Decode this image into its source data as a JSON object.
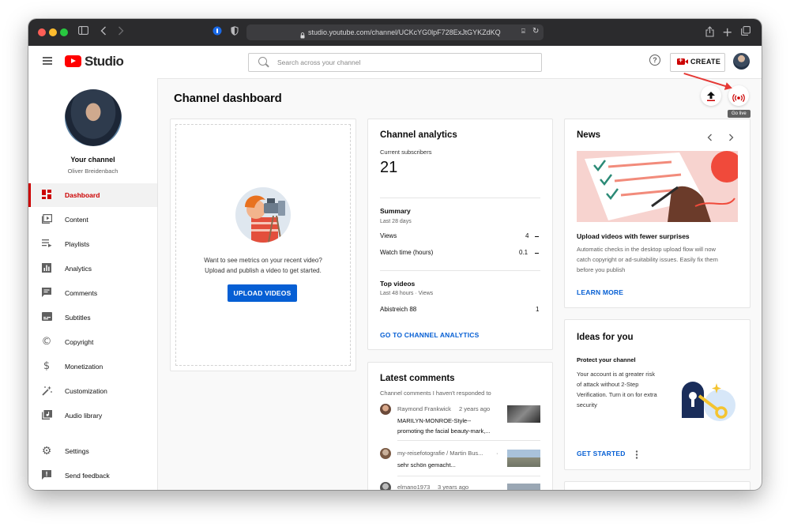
{
  "browser": {
    "url": "studio.youtube.com/channel/UCKcYG0lpF728ExJtGYKZdKQ",
    "icons": [
      "sidebar-icon",
      "back-icon",
      "forward-icon",
      "password-icon",
      "shield-icon",
      "lock-icon",
      "translate-icon",
      "reload-icon",
      "share-icon",
      "new-tab-icon",
      "tabs-icon"
    ]
  },
  "header": {
    "logo_text": "Studio",
    "search_placeholder": "Search across your channel",
    "create_label": "CREATE"
  },
  "sidebar": {
    "channel_label": "Your channel",
    "owner_name": "Oliver Breidenbach",
    "items": [
      {
        "label": "Dashboard",
        "icon": "dashboard-icon",
        "active": true
      },
      {
        "label": "Content",
        "icon": "content-icon"
      },
      {
        "label": "Playlists",
        "icon": "playlists-icon"
      },
      {
        "label": "Analytics",
        "icon": "analytics-icon"
      },
      {
        "label": "Comments",
        "icon": "comments-icon"
      },
      {
        "label": "Subtitles",
        "icon": "subtitles-icon"
      },
      {
        "label": "Copyright",
        "icon": "copyright-icon"
      },
      {
        "label": "Monetization",
        "icon": "monetization-icon"
      },
      {
        "label": "Customization",
        "icon": "customization-icon"
      },
      {
        "label": "Audio library",
        "icon": "audio-library-icon"
      },
      {
        "label": "Settings",
        "icon": "settings-icon"
      },
      {
        "label": "Send feedback",
        "icon": "feedback-icon"
      }
    ]
  },
  "main": {
    "title": "Channel dashboard",
    "go_live_tooltip": "Go live",
    "upload_card": {
      "hint_line1": "Want to see metrics on your recent video?",
      "hint_line2": "Upload and publish a video to get started.",
      "button": "UPLOAD VIDEOS"
    },
    "analytics": {
      "title": "Channel analytics",
      "subs_label": "Current subscribers",
      "subs_value": "21",
      "summary_title": "Summary",
      "summary_period": "Last 28 days",
      "rows": [
        {
          "label": "Views",
          "value": "4"
        },
        {
          "label": "Watch time (hours)",
          "value": "0.1"
        }
      ],
      "top_title": "Top videos",
      "top_period": "Last 48 hours · Views",
      "top_videos": [
        {
          "title": "Abistreich 88",
          "views": "1"
        }
      ],
      "link": "GO TO CHANNEL ANALYTICS"
    },
    "comments": {
      "title": "Latest comments",
      "subtitle": "Channel comments I haven't responded to",
      "items": [
        {
          "author": "Raymond Frankwick",
          "time": "2 years ago",
          "line1": "MARILYN-MONROE-Style--",
          "line2": "promoting the facial beauty-mark,..."
        },
        {
          "author": "my-reisefotografie / Martin Bus...",
          "time": "",
          "line1": "sehr schön gemacht...",
          "line2": ""
        },
        {
          "author": "elmano1973",
          "time": "3 years ago",
          "line1": "",
          "line2": ""
        }
      ]
    },
    "news": {
      "title": "News",
      "headline": "Upload videos with fewer surprises",
      "body": [
        "Automatic checks in the desktop upload flow will now",
        "catch copyright or ad-suitability issues. Easily fix them",
        "before you publish"
      ],
      "link": "LEARN MORE"
    },
    "ideas": {
      "title": "Ideas for you",
      "subtitle": "Protect your channel",
      "body": [
        "Your account is at greater risk",
        "of attack without 2-Step",
        "Verification. Turn it on for extra",
        "security"
      ],
      "link": "GET STARTED"
    }
  },
  "colors": {
    "accent_red": "#cc0000",
    "link_blue": "#065fd4",
    "annotation_arrow": "#e53935"
  }
}
